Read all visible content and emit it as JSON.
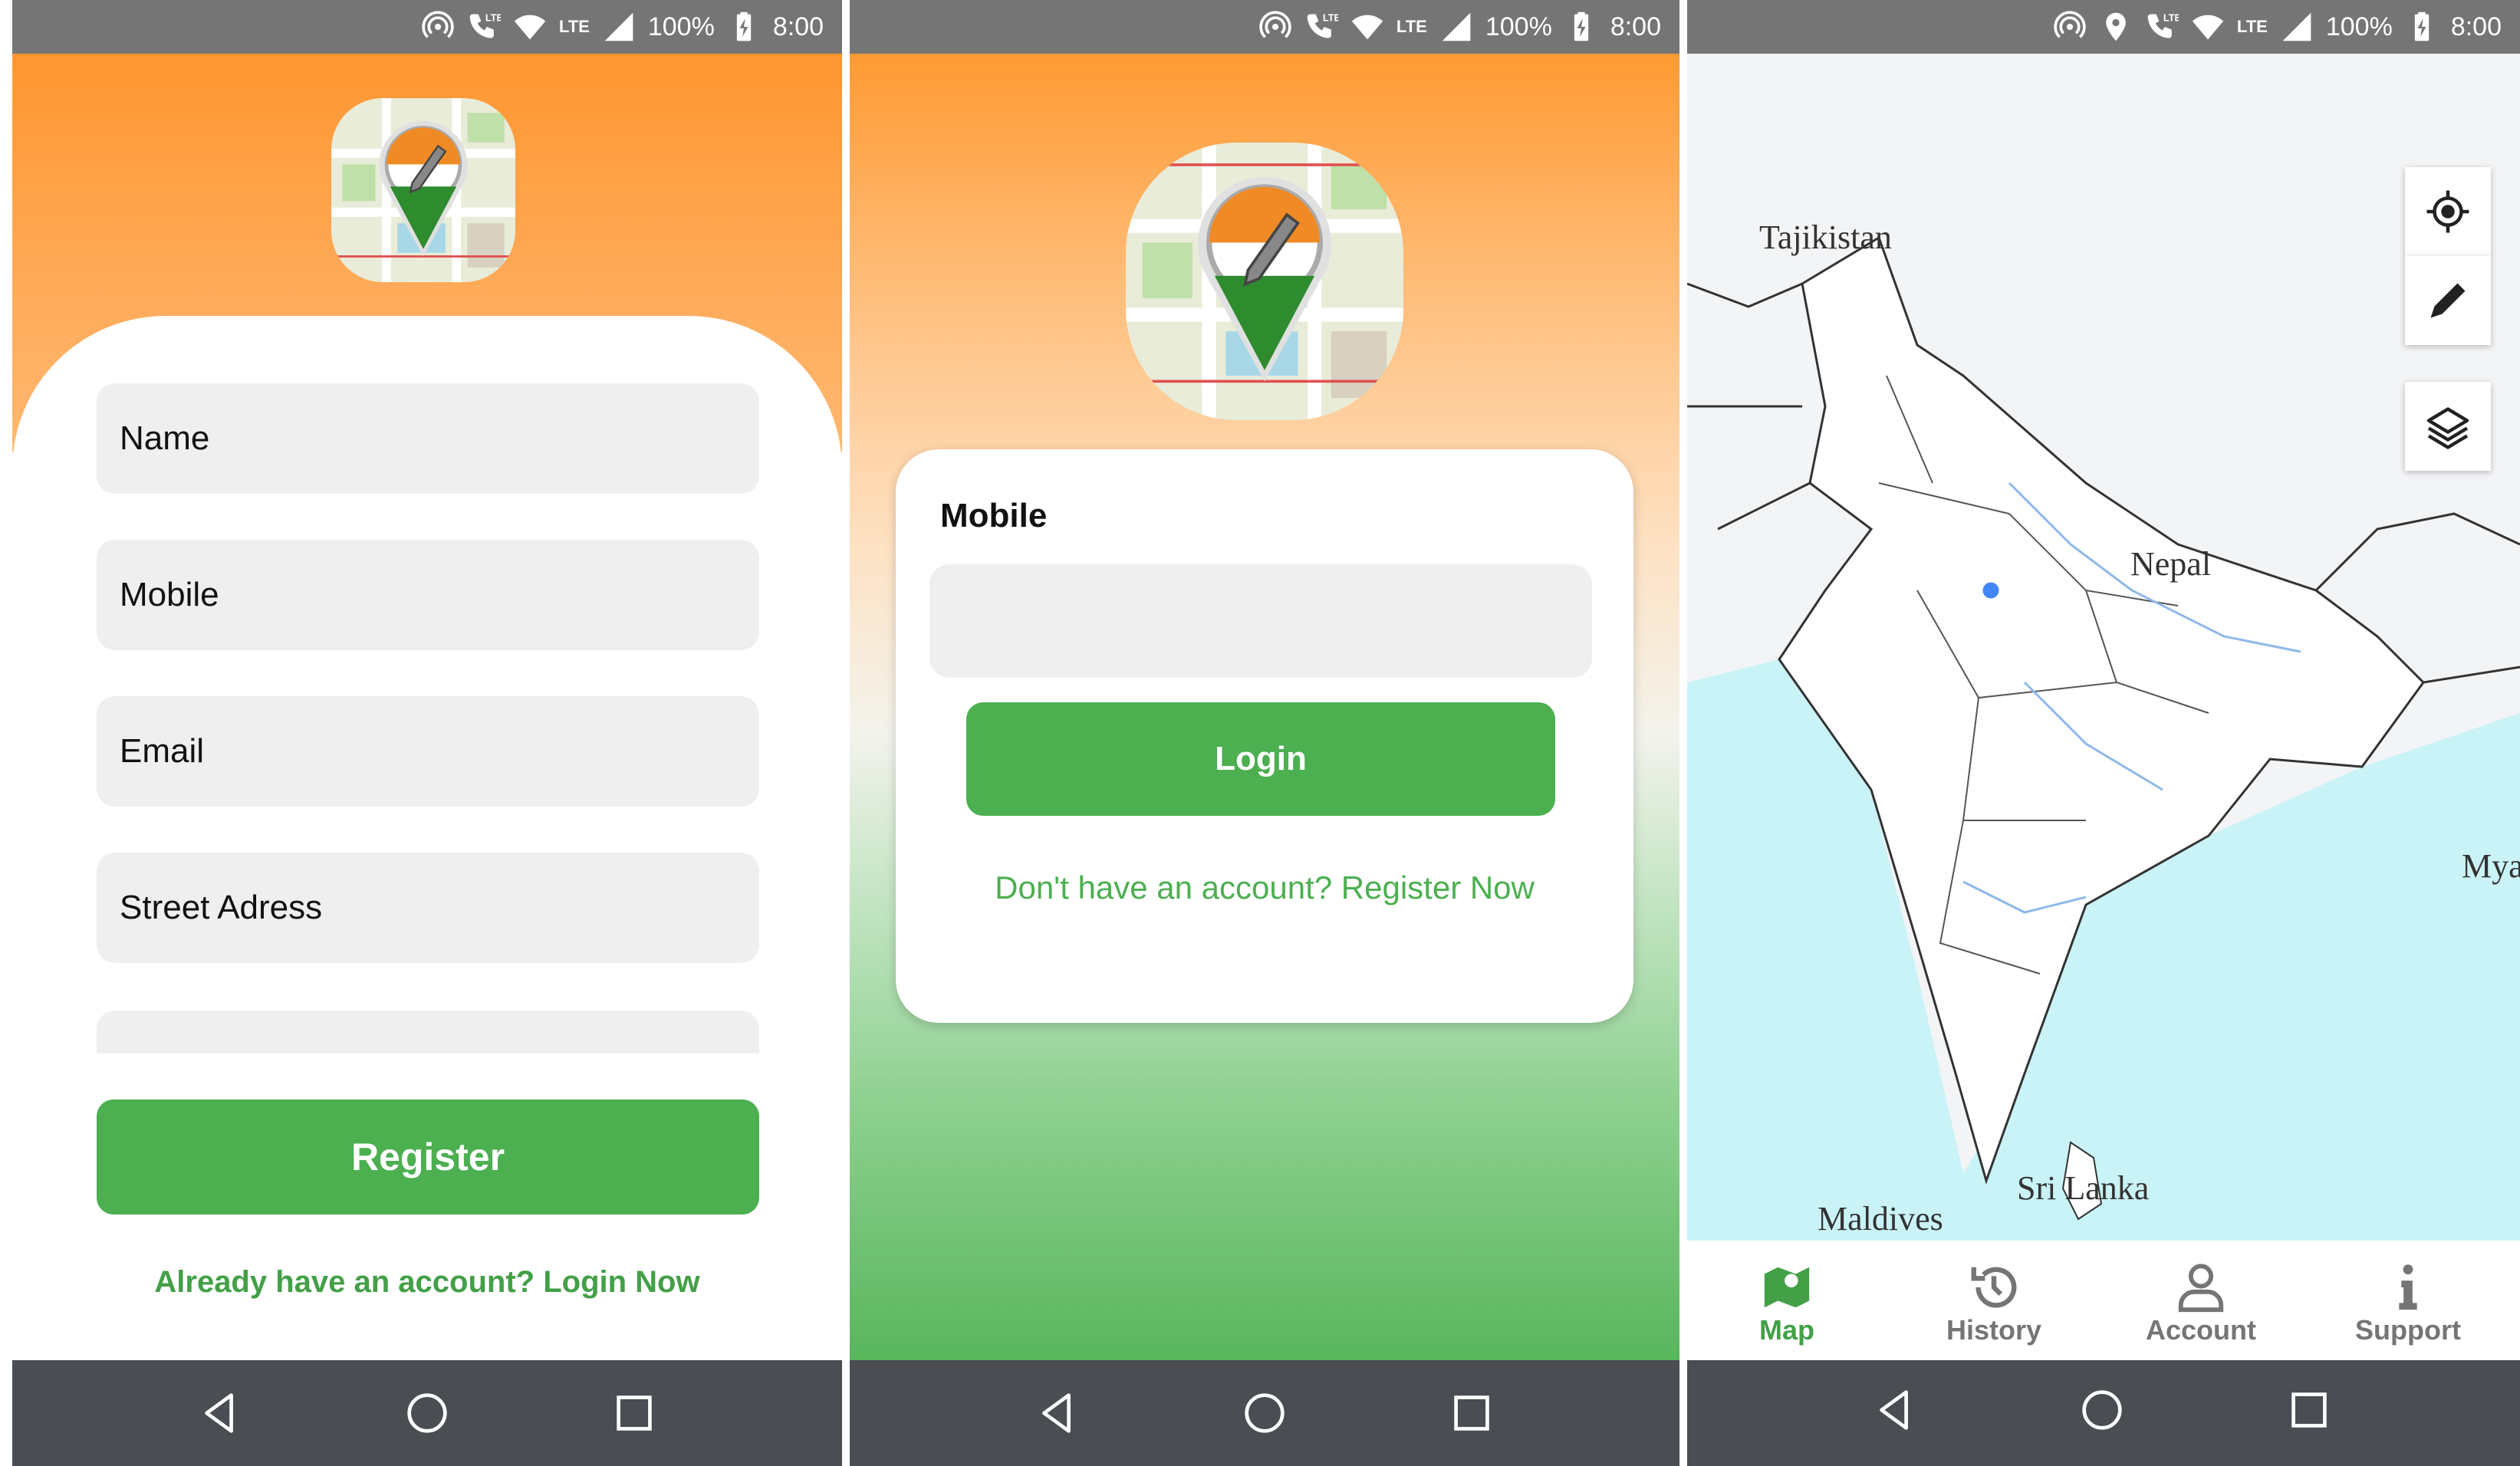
{
  "status_bar": {
    "battery": "100%",
    "time": "8:00",
    "network": "LTE"
  },
  "register_screen": {
    "fields": [
      "Name",
      "Mobile",
      "Email",
      "Street Adress"
    ],
    "register_label": "Register",
    "login_link": "Already have an account? Login Now"
  },
  "login_screen": {
    "mobile_label": "Mobile",
    "mobile_value": "",
    "login_label": "Login",
    "register_link": "Don't have an account? Register Now"
  },
  "map_screen": {
    "labels": {
      "tajikistan": "Tajikistan",
      "nepal": "Nepal",
      "myanmar": "Mya",
      "srilanka": "Sri Lanka",
      "maldives": "Maldives"
    },
    "tabs": [
      {
        "label": "Map",
        "active": true
      },
      {
        "label": "History",
        "active": false
      },
      {
        "label": "Account",
        "active": false
      },
      {
        "label": "Support",
        "active": false
      }
    ]
  },
  "colors": {
    "accent_green": "#4caf50",
    "link_green": "#43a047",
    "orange": "#ff9630",
    "status_gray": "#757575",
    "nav_gray": "#4a4d52",
    "sea": "#c9f3f7",
    "tab_inactive": "#757575"
  },
  "icons": [
    "hotspot-icon",
    "call-lte-icon",
    "wifi-icon",
    "signal-icon",
    "battery-charging-icon",
    "back-icon",
    "home-icon",
    "recents-icon",
    "my-location-icon",
    "pencil-icon",
    "layers-icon",
    "map-icon",
    "history-icon",
    "account-icon",
    "info-icon"
  ]
}
